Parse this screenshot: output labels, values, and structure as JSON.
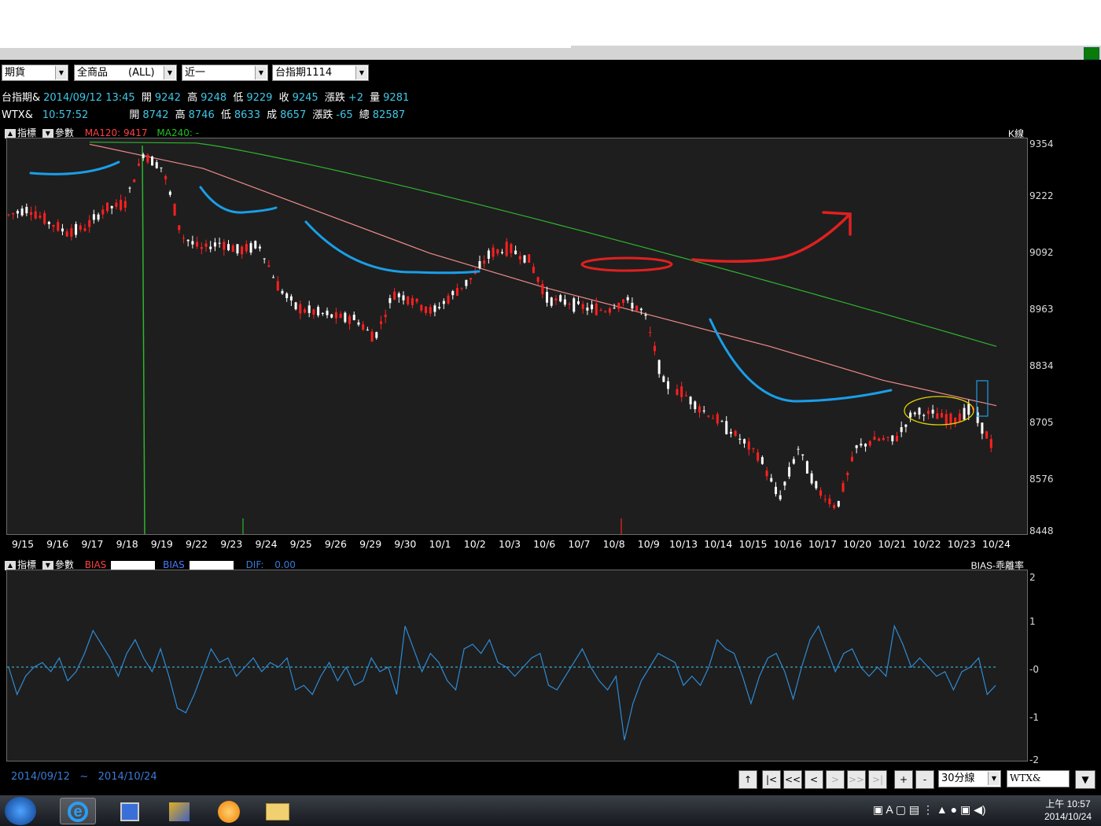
{
  "toolbar": {
    "market": "期貨",
    "product": "全商品　　(ALL)",
    "period": "近一",
    "contract": "台指期1114"
  },
  "info_line1": {
    "symbol": "台指期&",
    "datetime": "2014/09/12 13:45",
    "open_label": "開",
    "open": "9242",
    "high_label": "高",
    "high": "9248",
    "low_label": "低",
    "low": "9229",
    "close_label": "收",
    "close": "9245",
    "chg_label": "漲跌",
    "chg": "+2",
    "vol_label": "量",
    "vol": "9281"
  },
  "info_line2": {
    "symbol": "WTX&",
    "time": "10:57:52",
    "open_label": "開",
    "open": "8742",
    "high_label": "高",
    "high": "8746",
    "low_label": "低",
    "low": "8633",
    "deal_label": "成",
    "deal": "8657",
    "chg_label": "漲跌",
    "chg": "-65",
    "total_label": "總",
    "total": "82587"
  },
  "main_ctrl": {
    "indicator": "指標",
    "params": "參數",
    "ma120_label": "MA120:",
    "ma120": "9417",
    "ma240_label": "MA240:",
    "ma240": "-"
  },
  "main_title": "K線",
  "bias_ctrl": {
    "indicator": "指標",
    "params": "參數",
    "bias1": "BIAS",
    "bias2": "BIAS",
    "dif_label": "DIF:",
    "dif": "0.00"
  },
  "bias_title": "BIAS-乖離率",
  "price_axis": [
    "9354",
    "9222",
    "9092",
    "8963",
    "8834",
    "8705",
    "8576",
    "8448"
  ],
  "bias_axis": [
    "2",
    "1",
    "-0",
    "-1",
    "-2"
  ],
  "dates": [
    "9/15",
    "9/16",
    "9/17",
    "9/18",
    "9/19",
    "9/22",
    "9/23",
    "9/24",
    "9/25",
    "9/26",
    "9/29",
    "9/30",
    "10/1",
    "10/2",
    "10/3",
    "10/6",
    "10/7",
    "10/8",
    "10/9",
    "10/13",
    "10/14",
    "10/15",
    "10/16",
    "10/17",
    "10/20",
    "10/21",
    "10/22",
    "10/23",
    "10/24"
  ],
  "date_range": {
    "from": "2014/09/12",
    "sep": "~",
    "to": "2014/10/24"
  },
  "nav": {
    "up": "↑",
    "first": "|<",
    "fastback": "<<",
    "back": "<",
    "fwd": ">",
    "fastfwd": ">>",
    "last": ">|",
    "plus": "+",
    "minus": "-",
    "interval": "30分線",
    "symbol": "WTX&"
  },
  "chart_data": {
    "type": "candlestick",
    "title": "K線",
    "ylim": [
      8448,
      9354
    ],
    "series": [
      {
        "name": "MA120",
        "values": [
          9417,
          9300,
          9200,
          9100,
          9020,
          8950,
          8880,
          8800,
          8740
        ]
      },
      {
        "name": "MA240"
      }
    ],
    "close_path": [
      9190,
      9205,
      9175,
      9150,
      9160,
      9205,
      9215,
      9335,
      9300,
      9140,
      9110,
      9125,
      9105,
      9120,
      9020,
      8970,
      8960,
      8950,
      8945,
      8900,
      9005,
      8990,
      8960,
      9000,
      9040,
      9100,
      9110,
      9085,
      8990,
      8985,
      8970,
      8965,
      8990,
      8960,
      8795,
      8770,
      8730,
      8700,
      8660,
      8620,
      8520,
      8640,
      8540,
      8500,
      8640,
      8660,
      8660,
      8725,
      8720,
      8705,
      8735,
      8650
    ],
    "colors": {
      "ma120": "#f08a8a",
      "ma240": "#2fb42f",
      "up": "#ff2020",
      "down": "#ffffff",
      "bias": "#2e8bd6",
      "annotation_blue": "#1a9ee8",
      "annotation_red": "#e02020",
      "annotation_yellow": "#e0d000"
    }
  },
  "taskbar": {
    "time_prefix": "上午 10:57",
    "date": "2014/10/24"
  }
}
